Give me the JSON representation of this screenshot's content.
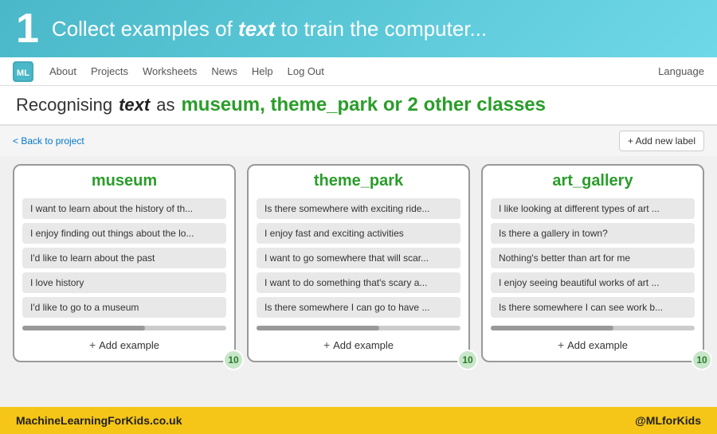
{
  "banner": {
    "number": "1",
    "prefix": "Collect examples of",
    "keyword": "text",
    "suffix": "to train the computer..."
  },
  "navbar": {
    "logo_text": "ML",
    "links": [
      "About",
      "Projects",
      "Worksheets",
      "News",
      "Help",
      "Log Out"
    ],
    "language": "Language"
  },
  "subtitle": {
    "prefix": "Recognising",
    "keyword": "text",
    "middle": "as",
    "classes": "museum, theme_park or 2 other classes"
  },
  "back_link": "< Back to project",
  "add_label_btn": "+ Add new label",
  "columns": [
    {
      "title": "museum",
      "examples": [
        "I want to learn about the history of th...",
        "I enjoy finding out things about the lo...",
        "I'd like to learn about the past",
        "I love history",
        "I'd like to go to a museum"
      ],
      "count": "10",
      "add_label": "Add example"
    },
    {
      "title": "theme_park",
      "examples": [
        "Is there somewhere with exciting ride...",
        "I enjoy fast and exciting activities",
        "I want to go somewhere that will scar...",
        "I want to do something that's scary a...",
        "Is there somewhere I can go to have ..."
      ],
      "count": "10",
      "add_label": "Add example"
    },
    {
      "title": "art_gallery",
      "examples": [
        "I like looking at different types of art ...",
        "Is there a gallery in town?",
        "Nothing's better than art for me",
        "I enjoy seeing beautiful works of art ...",
        "Is there somewhere I can see work b..."
      ],
      "count": "10",
      "add_label": "Add example"
    }
  ],
  "footer": {
    "left": "MachineLearningForKids.co.uk",
    "right": "@MLforKids"
  }
}
